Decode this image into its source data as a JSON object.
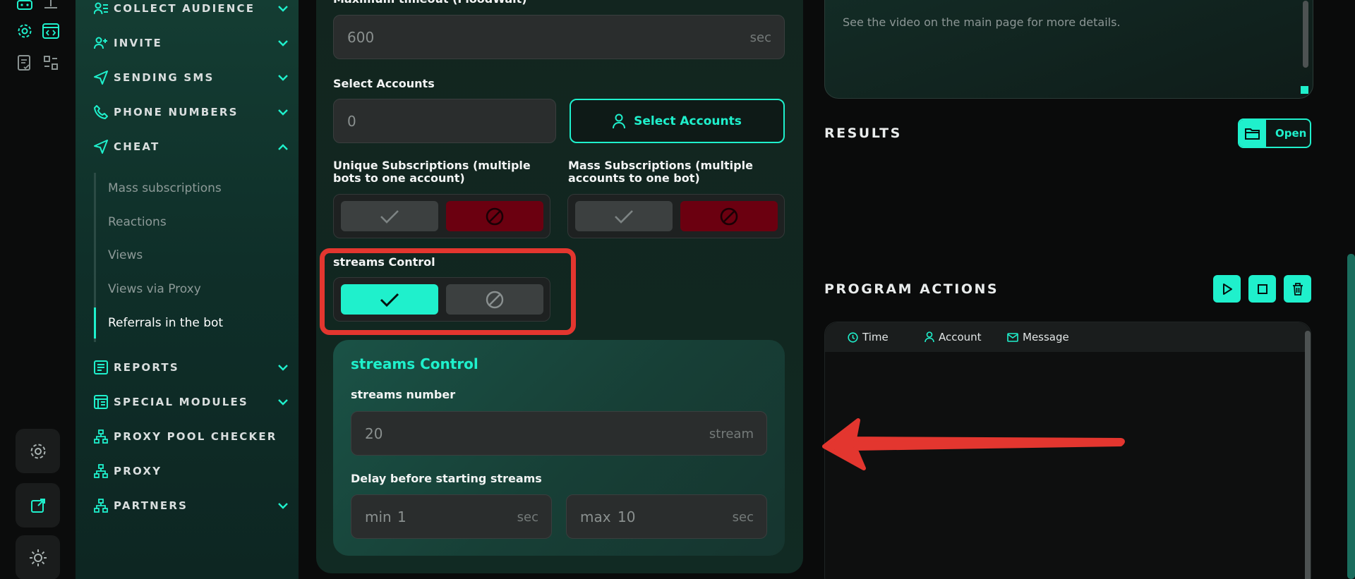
{
  "sidebar": {
    "items": [
      {
        "label": "COLLECT AUDIENCE",
        "icon": "users-list-icon",
        "expanded": false
      },
      {
        "label": "INVITE",
        "icon": "user-add-icon",
        "expanded": false
      },
      {
        "label": "SENDING SMS",
        "icon": "send-icon",
        "expanded": false
      },
      {
        "label": "PHONE NUMBERS",
        "icon": "phone-icon",
        "expanded": false
      },
      {
        "label": "CHEAT",
        "icon": "send-icon",
        "expanded": true
      },
      {
        "label": "REPORTS",
        "icon": "report-icon",
        "expanded": false
      },
      {
        "label": "SPECIAL MODULES",
        "icon": "modules-icon",
        "expanded": false
      },
      {
        "label": "PROXY POOL CHECKER",
        "icon": "network-icon",
        "expanded": false
      },
      {
        "label": "PROXY",
        "icon": "network-icon",
        "expanded": false
      },
      {
        "label": "PARTNERS",
        "icon": "network-icon",
        "expanded": true
      }
    ],
    "cheat_submenu": [
      "Mass subscriptions",
      "Reactions",
      "Views",
      "Views via Proxy",
      "Referrals in the bot"
    ],
    "active_submenu": "Referrals in the bot"
  },
  "form": {
    "timeout_label": "Maximum timeout (FloodWait)",
    "timeout_value": "600",
    "timeout_unit": "sec",
    "select_accounts_label": "Select Accounts",
    "select_accounts_value": "0",
    "select_accounts_button": "Select Accounts",
    "unique_subs_label": "Unique Subscriptions (multiple bots to one account)",
    "mass_subs_label": "Mass Subscriptions (multiple accounts to one bot)",
    "streams_control_label": "streams Control",
    "streams_card_title": "streams Control",
    "streams_number_label": "streams number",
    "streams_number_value": "20",
    "streams_number_unit": "stream",
    "delay_label": "Delay before starting streams",
    "delay_min_prefix": "min",
    "delay_min_value": "1",
    "delay_max_prefix": "max",
    "delay_max_value": "10",
    "delay_unit": "sec"
  },
  "right": {
    "description_text": "See the video on the main page for more details.",
    "results_title": "RESULTS",
    "open_label": "Open",
    "actions_title": "PROGRAM ACTIONS",
    "log_columns": [
      "Time",
      "Account",
      "Message"
    ]
  },
  "colors": {
    "accent": "#1ff0cc",
    "danger": "#6b0010",
    "highlight": "#e3362f"
  }
}
